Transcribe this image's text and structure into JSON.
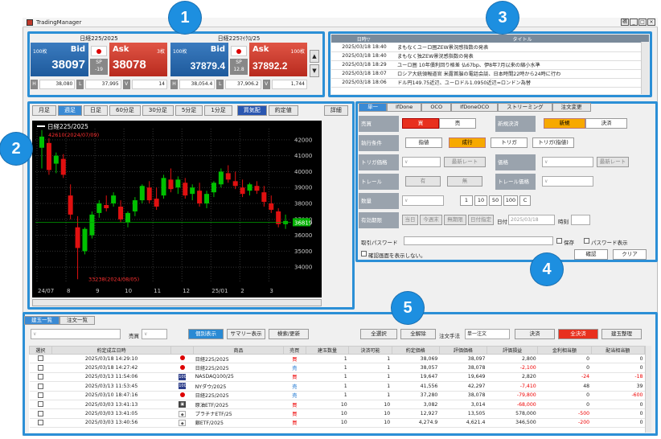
{
  "app": {
    "title": "TradingManager",
    "window_buttons": [
      "礁",
      "_",
      "□",
      "×"
    ]
  },
  "badges": [
    "1",
    "2",
    "3",
    "4",
    "5"
  ],
  "quotes": [
    {
      "name": "日経225/2025",
      "bid_lot": "100枚",
      "bid_label": "Bid",
      "bid": "38097",
      "ask_label": "Ask",
      "ask_lot": "3枚",
      "ask": "38078",
      "sp_label": "SP",
      "sp": "-19",
      "h": "38,080",
      "l": "37,995",
      "v": "14"
    },
    {
      "name": "日経225ﾏｲｸﾛ/25",
      "bid_lot": "100枚",
      "bid_label": "Bid",
      "bid": "37879.4",
      "ask_label": "Ask",
      "ask_lot": "100枚",
      "ask": "37892.2",
      "sp_label": "SP",
      "sp": "12.8",
      "h": "38,054.4",
      "l": "37,906.2",
      "v": "1,744"
    }
  ],
  "hlv_keys": {
    "h": "H",
    "l": "L",
    "v": "V"
  },
  "scroll": {
    "up": "▲",
    "down": "▼"
  },
  "news": {
    "section": "ニュース",
    "headers": [
      "日時▽",
      "タイトル"
    ],
    "rows": [
      [
        "2025/03/18 18:40",
        "まもなくユーロ圏ZEW景況感指数の発表"
      ],
      [
        "2025/03/18 18:40",
        "まもなく独ZEW景況感指数の発表"
      ],
      [
        "2025/03/18 18:29",
        "ユーロ圏 10年債利回り格差 仏67bp、伊8年7月以来の縮小水準"
      ],
      [
        "2025/03/18 18:07",
        "ロシア大統領報道官 米露首脳の電話会談、日本時間22時から24時に行わ"
      ],
      [
        "2025/03/18 18:06",
        "ドル円149.75近辺、ユーロドル1.0950近辺=ロンドン為替"
      ]
    ]
  },
  "chart_tabs": [
    "月足",
    "週足",
    "日足",
    "60分足",
    "30分足",
    "5分足",
    "1分足",
    "買気配",
    "約定値",
    "詳細"
  ],
  "chart_data": {
    "type": "candlestick",
    "title": "日経225/2025",
    "high_label": "42610(2024/07/09)",
    "low_label": "33238(2024/08/05)",
    "current": "36819",
    "ylim": [
      33000,
      42700
    ],
    "yticks": [
      34000,
      35000,
      36000,
      37000,
      38000,
      39000,
      40000,
      41000,
      42000
    ],
    "xticks": [
      "24/07",
      "8",
      "9",
      "10",
      "11",
      "12",
      "25/01",
      "2",
      "3"
    ],
    "candles": [
      [
        41500,
        42610,
        40200,
        42200
      ],
      [
        41800,
        42100,
        39800,
        40100
      ],
      [
        40500,
        41200,
        39900,
        41000
      ],
      [
        40800,
        41100,
        39600,
        39800
      ],
      [
        38500,
        39200,
        37000,
        37300
      ],
      [
        36500,
        37200,
        33238,
        35200
      ],
      [
        35000,
        36500,
        34800,
        36400
      ],
      [
        36000,
        37500,
        35800,
        37300
      ],
      [
        37400,
        38200,
        37100,
        38000
      ],
      [
        37900,
        38500,
        37500,
        37700
      ],
      [
        38000,
        38700,
        37800,
        38500
      ],
      [
        37800,
        38200,
        36800,
        37000
      ],
      [
        36800,
        37500,
        36500,
        37400
      ],
      [
        37500,
        38400,
        37200,
        38200
      ],
      [
        38200,
        39200,
        38000,
        39100
      ],
      [
        39000,
        39400,
        38000,
        38200
      ],
      [
        38300,
        39000,
        37600,
        37800
      ],
      [
        38500,
        39800,
        38300,
        39600
      ],
      [
        39500,
        40200,
        38700,
        38900
      ],
      [
        39000,
        39700,
        38600,
        39500
      ],
      [
        39300,
        39600,
        38300,
        38500
      ],
      [
        38600,
        39200,
        38200,
        39000
      ],
      [
        38800,
        39300,
        37800,
        38000
      ],
      [
        38000,
        38800,
        37700,
        38600
      ],
      [
        38700,
        39400,
        38400,
        39300
      ],
      [
        39200,
        40200,
        39000,
        40000
      ],
      [
        39900,
        40400,
        39300,
        39500
      ],
      [
        39400,
        40000,
        38900,
        39100
      ],
      [
        39000,
        39500,
        38400,
        38600
      ],
      [
        38800,
        39300,
        38500,
        39200
      ],
      [
        39100,
        39400,
        38600,
        38800
      ],
      [
        38700,
        39100,
        37800,
        38100
      ],
      [
        38000,
        38500,
        37400,
        37600
      ],
      [
        37500,
        37700,
        36500,
        36700
      ],
      [
        36700,
        37300,
        36400,
        36900
      ]
    ]
  },
  "order": {
    "tabs": [
      "単一",
      "IfDone",
      "OCO",
      "IfDoneOCO",
      "ストリーミング",
      "注文変更"
    ],
    "side_label": "売買",
    "buy": "買",
    "sell": "売",
    "settle_label": "新規決済",
    "new": "新規",
    "settle": "決済",
    "cond_label": "執行条件",
    "conds": [
      "指値",
      "成行",
      "トリガ",
      "トリガ(指値)"
    ],
    "trig_label": "トリガ価格",
    "price_label": "価格",
    "latest": "最新レート",
    "trail_label": "トレール",
    "has": "有",
    "none": "無",
    "trail_price_label": "トレール価格",
    "qty_label": "数量",
    "qty_btns": [
      "1",
      "10",
      "50",
      "100",
      "C"
    ],
    "valid_label": "有効期限",
    "valid_btns": [
      "当日",
      "今週末",
      "無期限",
      "日付指定"
    ],
    "date_label": "日付",
    "date_value": "2025/03/18",
    "time_label": "時刻",
    "pwd_label": "取引パスワード",
    "save": "保存",
    "show_pwd": "パスワード表示",
    "no_confirm": "確認画面を表示しない。",
    "confirm": "確認",
    "clear": "クリア"
  },
  "positions": {
    "tabs": [
      "建玉一覧",
      "注文一覧"
    ],
    "sell_label": "売買",
    "buttons": {
      "bulk": "個別表示",
      "summary": "サマリー表示",
      "search": "検索/更新",
      "select_all": "全選択",
      "deselect": "全解除",
      "method_label": "注文手法",
      "method": "単一注文",
      "settle": "決済",
      "all_settle": "全決済",
      "organize": "建玉整理"
    },
    "headers": [
      "選択",
      "約定成立日時",
      "",
      "商品",
      "売買",
      "建玉数量",
      "決済可能",
      "約定価格",
      "評価価格",
      "評価損益",
      "金利相当額",
      "配当相当額"
    ],
    "rows": [
      {
        "dt": "2025/03/18 14:29:10",
        "icon": "jp",
        "name": "日経225/2025",
        "side": "買",
        "qty": "1",
        "can": "1",
        "price": "38,069",
        "eval": "38,097",
        "pl": "2,800",
        "int": "0",
        "div": "0"
      },
      {
        "dt": "2025/03/18 14:27:42",
        "icon": "jp",
        "name": "日経225/2025",
        "side": "売",
        "qty": "1",
        "can": "1",
        "price": "38,057",
        "eval": "38,078",
        "pl": "-2,100",
        "int": "0",
        "div": "0"
      },
      {
        "dt": "2025/03/13 11:54:06",
        "icon": "us",
        "name": "NASDAQ100/25",
        "side": "買",
        "qty": "1",
        "can": "1",
        "price": "19,647",
        "eval": "19,649",
        "pl": "2,820",
        "int": "-24",
        "div": "-18"
      },
      {
        "dt": "2025/03/13 11:53:45",
        "icon": "us",
        "name": "NYダウ/2025",
        "side": "売",
        "qty": "1",
        "can": "1",
        "price": "41,556",
        "eval": "42,297",
        "pl": "-7,410",
        "int": "48",
        "div": "39"
      },
      {
        "dt": "2025/03/10 18:47:16",
        "icon": "jp",
        "name": "日経225/2025",
        "side": "売",
        "qty": "1",
        "can": "1",
        "price": "37,280",
        "eval": "38,078",
        "pl": "-79,800",
        "int": "0",
        "div": "-600"
      },
      {
        "dt": "2025/03/03 13:41:13",
        "icon": "etf",
        "name": "原油ETF/2025",
        "side": "買",
        "qty": "10",
        "can": "10",
        "price": "3,082",
        "eval": "3,014",
        "pl": "-68,000",
        "int": "0",
        "div": "0"
      },
      {
        "dt": "2025/03/03 13:41:05",
        "icon": "metal",
        "name": "プラチナETF/25",
        "side": "買",
        "qty": "10",
        "can": "10",
        "price": "12,927",
        "eval": "13,505",
        "pl": "578,000",
        "int": "-500",
        "div": "0"
      },
      {
        "dt": "2025/03/03 13:40:56",
        "icon": "metal",
        "name": "銀ETF/2025",
        "side": "買",
        "qty": "10",
        "can": "10",
        "price": "4,274.9",
        "eval": "4,621.4",
        "pl": "346,500",
        "int": "-200",
        "div": "0"
      }
    ]
  },
  "colors": {
    "highlight": "#2b8fd6",
    "bid": "#1e5a9c",
    "ask": "#b82a1e",
    "up": "#00c000",
    "down": "#e01010"
  }
}
